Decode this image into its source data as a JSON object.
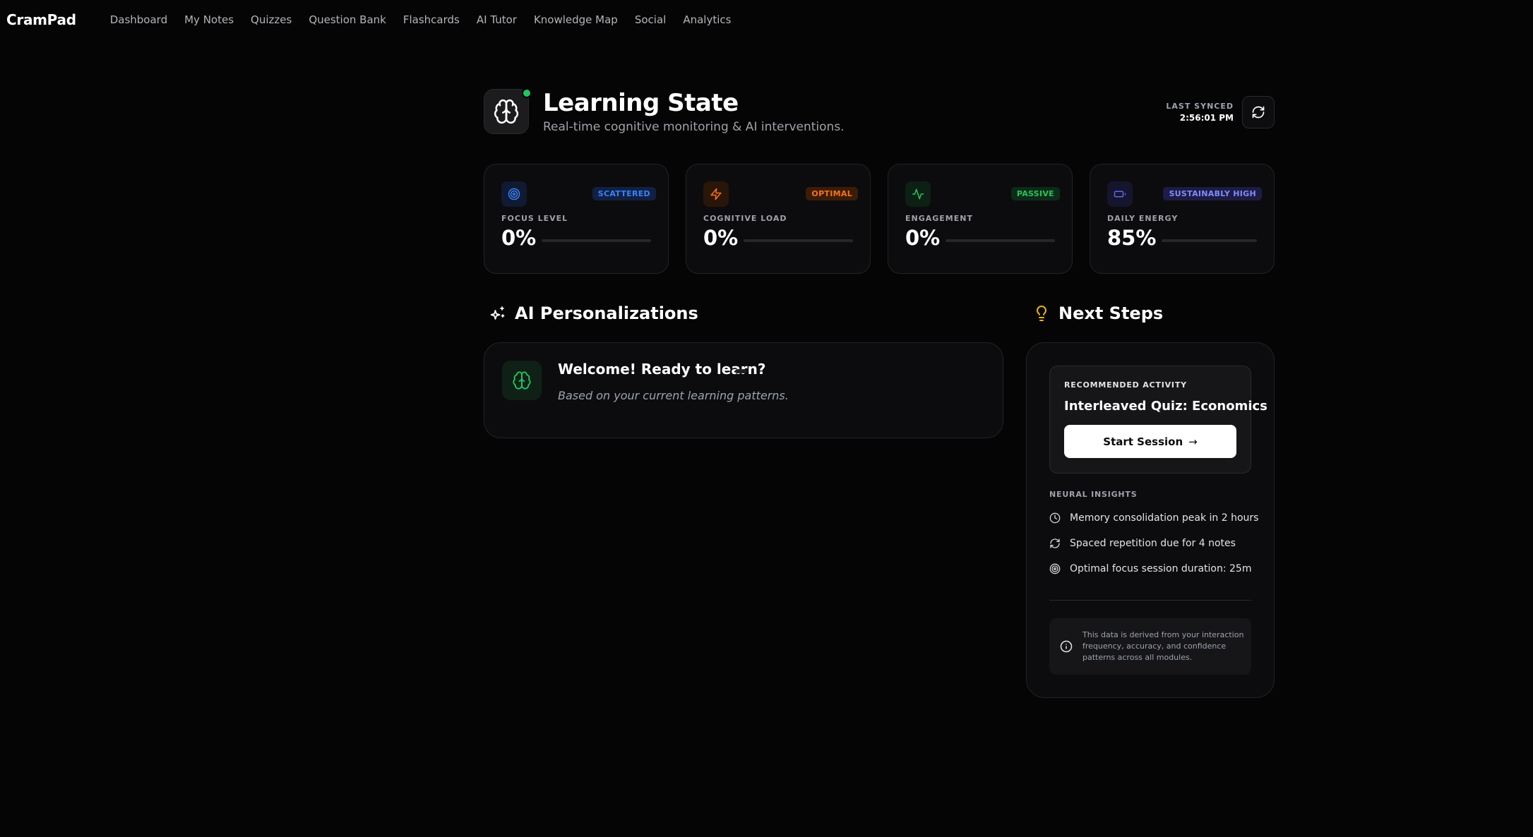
{
  "nav": {
    "brand": "CramPad",
    "links": [
      "Dashboard",
      "My Notes",
      "Quizzes",
      "Question Bank",
      "Flashcards",
      "AI Tutor",
      "Knowledge Map",
      "Social",
      "Analytics"
    ]
  },
  "header": {
    "title": "Learning State",
    "subtitle": "Real-time cognitive monitoring & AI interventions.",
    "sync_label": "LAST SYNCED",
    "sync_time": "2:56:01 PM",
    "status_color": "#22c55e"
  },
  "stats": [
    {
      "label": "FOCUS LEVEL",
      "value": "0%",
      "level": 0,
      "badge": "SCATTERED",
      "icon": "target-icon",
      "color": "#3b82f6"
    },
    {
      "label": "COGNITIVE LOAD",
      "value": "0%",
      "level": 0,
      "badge": "OPTIMAL",
      "icon": "zap-icon",
      "color": "#f97316"
    },
    {
      "label": "ENGAGEMENT",
      "value": "0%",
      "level": 0,
      "badge": "PASSIVE",
      "icon": "activity-icon",
      "color": "#22c55e"
    },
    {
      "label": "DAILY ENERGY",
      "value": "85%",
      "level": 0,
      "badge": "SUSTAINABLY HIGH",
      "icon": "battery-icon",
      "color": "#6366f1"
    }
  ],
  "personalizations": {
    "title": "AI Personalizations",
    "card_title": "Welcome! Ready to learn?",
    "card_desc": "Based on your current learning patterns."
  },
  "next_steps": {
    "title": "Next Steps",
    "rec_label": "RECOMMENDED ACTIVITY",
    "rec_title": "Interleaved Quiz: Economics",
    "start_label": "Start Session",
    "neural_label": "NEURAL INSIGHTS",
    "insights": [
      {
        "text": "Memory consolidation peak in 2 hours",
        "icon": "clock-icon"
      },
      {
        "text": "Spaced repetition due for 4 notes",
        "icon": "refresh-icon"
      },
      {
        "text": "Optimal focus session duration: 25m",
        "icon": "target-icon"
      }
    ],
    "info": "This data is derived from your interaction frequency, accuracy, and confidence patterns across all modules."
  }
}
